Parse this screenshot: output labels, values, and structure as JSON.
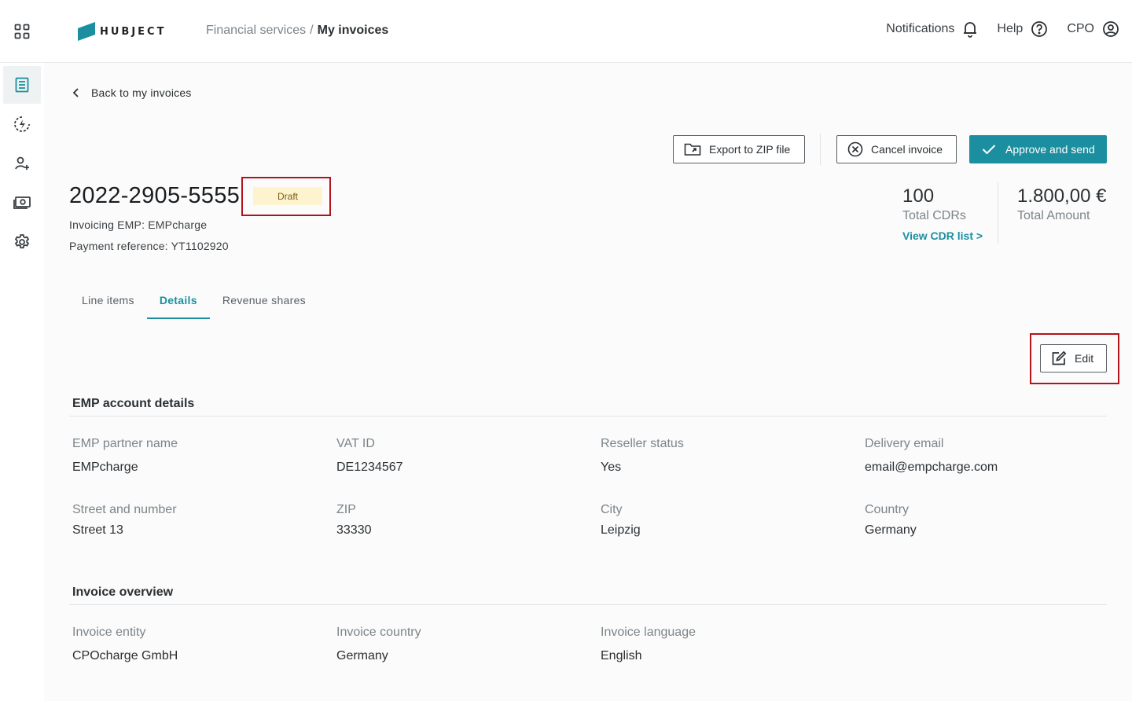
{
  "header": {
    "logo_text": "HUBJECT",
    "breadcrumb": {
      "root": "Financial services",
      "separator": "/",
      "current": "My invoices"
    },
    "nav": {
      "notifications": "Notifications",
      "help": "Help",
      "user": "CPO"
    }
  },
  "sidebar": {
    "items": [
      {
        "icon": "invoice-list-icon",
        "active": true
      },
      {
        "icon": "charging-lightning-icon",
        "active": false
      },
      {
        "icon": "add-user-icon",
        "active": false
      },
      {
        "icon": "money-icon",
        "active": false
      },
      {
        "icon": "gear-icon",
        "active": false
      }
    ]
  },
  "page": {
    "back_label": "Back to my invoices",
    "actions": {
      "export": "Export to ZIP file",
      "cancel": "Cancel invoice",
      "approve": "Approve and send"
    },
    "invoice_id": "2022-2905-5555",
    "status": "Draft",
    "invoicing_emp": "Invoicing EMP: EMPcharge",
    "payment_reference": "Payment reference: YT1102920",
    "stats": {
      "cdrs_value": "100",
      "cdrs_label": "Total CDRs",
      "cdr_link": "View CDR list >",
      "amount_value": "1.800,00 €",
      "amount_label": "Total Amount"
    },
    "tabs": [
      {
        "label": "Line items",
        "active": false
      },
      {
        "label": "Details",
        "active": true
      },
      {
        "label": "Revenue shares",
        "active": false
      }
    ],
    "edit_label": "Edit"
  },
  "emp_section": {
    "title": "EMP account details",
    "fields": [
      {
        "label": "EMP partner name",
        "value": "EMPcharge"
      },
      {
        "label": "VAT ID",
        "value": "DE1234567"
      },
      {
        "label": "Reseller status",
        "value": "Yes"
      },
      {
        "label": "Delivery email",
        "value": "email@empcharge.com"
      },
      {
        "label": "Street and number",
        "value": "Street 13"
      },
      {
        "label": "ZIP",
        "value": "33330"
      },
      {
        "label": "City",
        "value": "Leipzig"
      },
      {
        "label": "Country",
        "value": "Germany"
      }
    ]
  },
  "overview_section": {
    "title": "Invoice overview",
    "fields": [
      {
        "label": "Invoice entity",
        "value": "CPOcharge GmbH"
      },
      {
        "label": "Invoice country",
        "value": "Germany"
      },
      {
        "label": "Invoice language",
        "value": "English"
      }
    ]
  },
  "colors": {
    "accent": "#1b8fa0",
    "highlight_frame": "#b3131b",
    "draft_badge": "#fdf3cf"
  }
}
